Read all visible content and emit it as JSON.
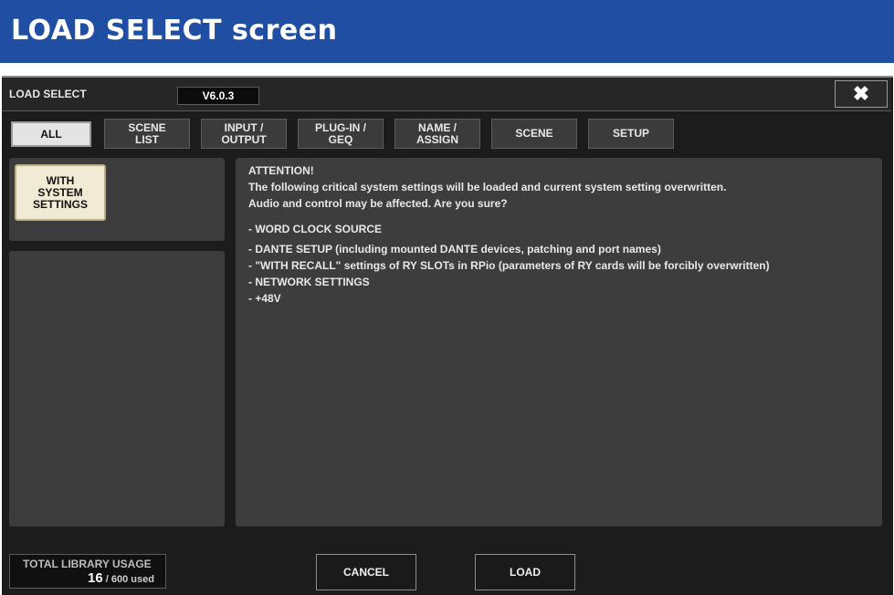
{
  "banner": {
    "title": "LOAD SELECT screen"
  },
  "window": {
    "title": "LOAD SELECT",
    "version": "V6.0.3",
    "close_icon": "✖"
  },
  "tabs": [
    {
      "label": "ALL",
      "active": true
    },
    {
      "label": "SCENE\nLIST",
      "active": false
    },
    {
      "label": "INPUT /\nOUTPUT",
      "active": false
    },
    {
      "label": "PLUG-IN /\nGEQ",
      "active": false
    },
    {
      "label": "NAME /\nASSIGN",
      "active": false
    },
    {
      "label": "SCENE",
      "active": false
    },
    {
      "label": "SETUP",
      "active": false
    }
  ],
  "left_panel": {
    "with_system_settings_label": "WITH\nSYSTEM\nSETTINGS"
  },
  "message": {
    "heading": "ATTENTION!",
    "line1": "The following critical system settings will be loaded and current system setting overwritten.",
    "line2": "Audio and control may be affected. Are you sure?",
    "items": [
      "- WORD CLOCK SOURCE",
      "- DANTE SETUP (including mounted DANTE devices, patching and port names)",
      "- \"WITH RECALL\" settings of RY SLOTs in RPio (parameters of RY cards will be forcibly overwritten)",
      "- NETWORK SETTINGS",
      "- +48V"
    ]
  },
  "footer": {
    "usage_label": "TOTAL LIBRARY USAGE",
    "usage_count": "16",
    "usage_total": " / 600 used",
    "cancel_label": "CANCEL",
    "load_label": "LOAD"
  }
}
